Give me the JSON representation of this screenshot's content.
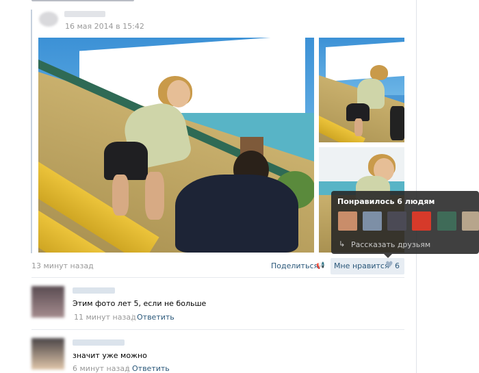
{
  "post": {
    "date": "16 мая 2014 в 15:42",
    "meta_time": "13 минут назад",
    "share_label": "Поделиться",
    "like_label": "Мне нравится",
    "like_count": "6"
  },
  "likes_popup": {
    "title": "Понравилось 6 людям",
    "tell_friends": "Рассказать друзьям",
    "avatars": [
      {
        "color": "#c98d6a"
      },
      {
        "color": "#7d8fa6"
      },
      {
        "color": "#4b4a55"
      },
      {
        "color": "#d63a2a"
      },
      {
        "color": "#3f6b58"
      },
      {
        "color": "#b7a58c"
      }
    ]
  },
  "comments": [
    {
      "text": "Этим фото лет 5, если не больше",
      "time": "11 минут назад",
      "reply": "Ответить",
      "separator": "|",
      "avatar_color": "#8b6f73"
    },
    {
      "text": "значит уже можно",
      "time": "6 минут назад",
      "reply": "Ответить",
      "separator": "|",
      "avatar_color": "#d0b79d"
    }
  ],
  "colors": {
    "link": "#2b587a",
    "muted": "#999999",
    "like_bg": "#e7edf3"
  }
}
